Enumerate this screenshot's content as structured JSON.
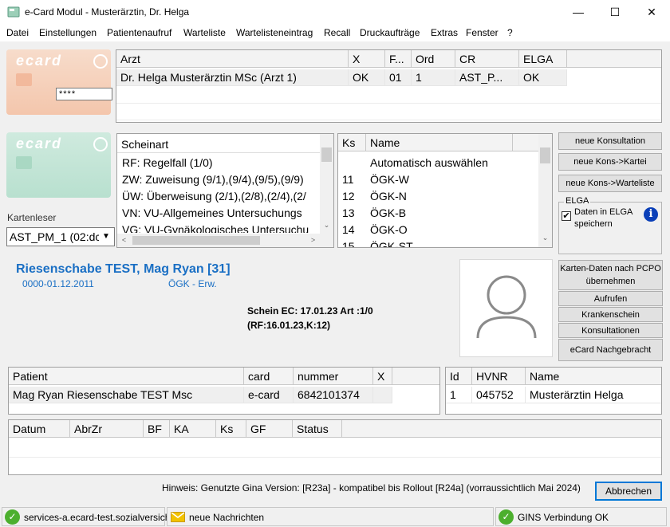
{
  "window": {
    "title": "e-Card Modul - Musterärztin, Dr. Helga",
    "minimize": "—",
    "maximize": "☐",
    "close": "✕"
  },
  "menu": [
    "Datei",
    "Einstellungen",
    "Patientenaufruf",
    "Warteliste",
    "Wartelisteneintrag",
    "Recall",
    "Druckaufträge",
    "Extras",
    "Fenster",
    "?"
  ],
  "card1": {
    "logo": "ecard",
    "pin": "****"
  },
  "card2": {
    "logo": "ecard"
  },
  "arzt_table": {
    "headers": [
      "Arzt",
      "X",
      "F...",
      "Ord",
      "CR",
      "ELGA"
    ],
    "rows": [
      [
        "Dr. Helga Musterärztin MSc (Arzt 1)",
        "OK",
        "01",
        "1",
        "AST_P...",
        "OK"
      ]
    ]
  },
  "kartenleser": {
    "label": "Kartenleser",
    "value": "AST_PM_1 (02:dc"
  },
  "scheinart": {
    "header": "Scheinart",
    "items": [
      "RF: Regelfall (1/0)",
      "ZW: Zuweisung (9/1),(9/4),(9/5),(9/9)",
      "ÜW: Überweisung (2/1),(2/8),(2/4),(2/",
      "VN: VU-Allgemeines Untersuchungs",
      "VG: VU-Gynäkologisches Untersuchu"
    ]
  },
  "kasse": {
    "headers": [
      "Ks",
      "Name"
    ],
    "rows": [
      [
        "",
        "Automatisch auswählen"
      ],
      [
        "11",
        "ÖGK-W"
      ],
      [
        "12",
        "ÖGK-N"
      ],
      [
        "13",
        "ÖGK-B"
      ],
      [
        "14",
        "ÖGK-O"
      ],
      [
        "15",
        "ÖGK-ST"
      ]
    ]
  },
  "buttons_right": [
    "neue Konsultation",
    "neue Kons->Kartei",
    "neue Kons->Warteliste"
  ],
  "elga": {
    "group_label": "ELGA",
    "checkbox_label": "Daten in ELGA speichern",
    "checked": true,
    "info_icon": "info-icon"
  },
  "patient": {
    "name": "Riesenschabe TEST, Mag Ryan [31]",
    "id_range": "0000-01.12.2011",
    "kasse": "ÖGK - Erw.",
    "schein_line1": "Schein EC: 17.01.23  Art :1/0",
    "schein_line2": "(RF:16.01.23,K:12)"
  },
  "buttons_patient": [
    "Karten-Daten nach PCPO übernehmen",
    "Aufrufen",
    "Krankenschein",
    "Konsultationen",
    "eCard Nachgebracht"
  ],
  "patient_table": {
    "headers": [
      "Patient",
      "card",
      "nummer",
      "X"
    ],
    "rows": [
      [
        "Mag Ryan Riesenschabe TEST Msc",
        "e-card",
        "6842101374",
        ""
      ]
    ]
  },
  "hvnr_table": {
    "headers": [
      "Id",
      "HVNR",
      "Name"
    ],
    "rows": [
      [
        "1",
        "045752",
        "Musterärztin Helga"
      ]
    ]
  },
  "kons_table": {
    "headers": [
      "Datum",
      "AbrZr",
      "BF",
      "KA",
      "Ks",
      "GF",
      "Status"
    ],
    "rows": []
  },
  "hint": "Hinweis: Genutzte Gina Version: [R23a] - kompatibel bis Rollout [R24a] (vorraussichtlich Mai 2024)",
  "cancel_button": "Abbrechen",
  "statusbar": {
    "service": "services-a.ecard-test.sozialversich",
    "messages": "neue Nachrichten",
    "gins": "GINS Verbindung OK"
  },
  "colors": {
    "patient_blue": "#1a6fc4",
    "status_ok": "#4caf2e",
    "card_orange": "#f4c9b0",
    "card_green": "#bfe3d4"
  }
}
